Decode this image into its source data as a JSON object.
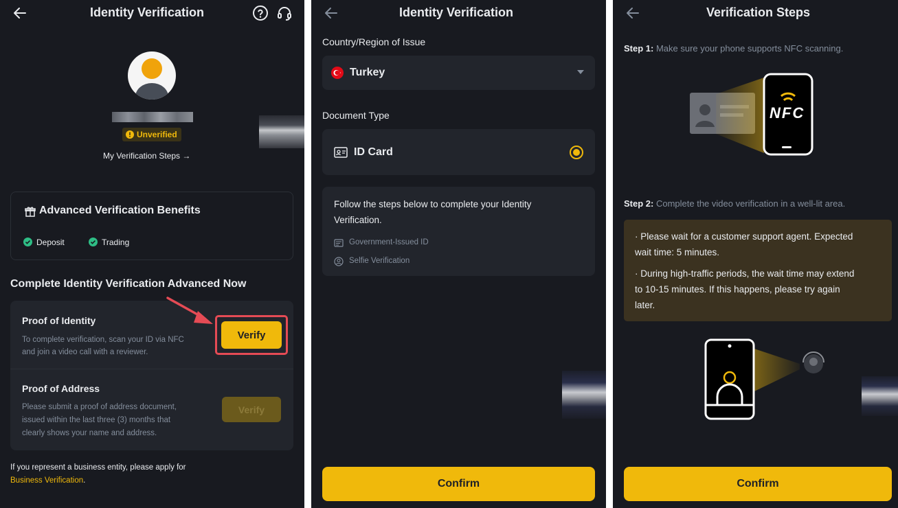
{
  "colors": {
    "background": "#181a20",
    "card": "#22252c",
    "accent": "#f0b90b",
    "success": "#2ebd85",
    "highlight": "#e54b55"
  },
  "panel1": {
    "title": "Identity Verification",
    "help_icon": "help-circle-icon",
    "support_icon": "headset-icon",
    "status_badge": "Unverified",
    "steps_link": "My Verification Steps →",
    "benefits": {
      "title": "Advanced Verification Benefits",
      "items": [
        "Deposit",
        "Trading"
      ]
    },
    "section_title": "Complete Identity Verification Advanced Now",
    "identity": {
      "title": "Proof of Identity",
      "desc_line1": "To complete verification, scan your ID via NFC",
      "desc_line2": "and join a video call with a reviewer.",
      "button": "Verify"
    },
    "address": {
      "title": "Proof of Address",
      "desc_line1": "Please submit a proof of address document,",
      "desc_line2": "issued within the last three (3) months that",
      "desc_line3": "clearly shows your name and address.",
      "button": "Verify"
    },
    "footer_line1": "If you represent a business entity, please apply for",
    "footer_link": "Business Verification",
    "footer_end": "."
  },
  "panel2": {
    "title": "Identity Verification",
    "country_label": "Country/Region of Issue",
    "country_value": "Turkey",
    "doc_label": "Document Type",
    "doc_value": "ID Card",
    "info_line1": "Follow the steps below to complete your Identity",
    "info_line2": "Verification.",
    "info_items": [
      "Government-Issued ID",
      "Selfie Verification"
    ],
    "confirm": "Confirm"
  },
  "panel3": {
    "title": "Verification Steps",
    "step1_label": "Step 1:",
    "step1_text": " Make sure your phone supports NFC scanning.",
    "nfc_text": "NFC",
    "step2_label": "Step 2:",
    "step2_text": " Complete the video verification in a well-lit area.",
    "note1_line1": "· Please wait for a customer support agent. Expected",
    "note1_line2": "wait time: 5 minutes.",
    "note2_line1": "· During high-traffic periods, the wait time may extend",
    "note2_line2": "to 10-15 minutes. If this happens, please try again",
    "note2_line3": "later.",
    "confirm": "Confirm"
  }
}
